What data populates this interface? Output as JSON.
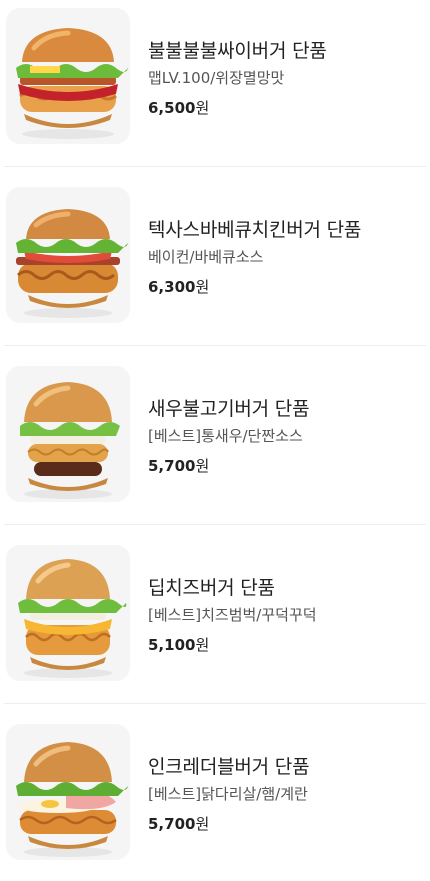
{
  "menu": {
    "items": [
      {
        "name": "불불불불싸이버거 단품",
        "desc": "맵LV.100/위장멸망맛",
        "price": "6,500",
        "unit": "원"
      },
      {
        "name": "텍사스바베큐치킨버거 단품",
        "desc": "베이컨/바베큐소스",
        "price": "6,300",
        "unit": "원"
      },
      {
        "name": "새우불고기버거 단품",
        "desc": "[베스트]통새우/단짠소스",
        "price": "5,700",
        "unit": "원"
      },
      {
        "name": "딥치즈버거 단품",
        "desc": "[베스트]치즈범벅/꾸덕꾸덕",
        "price": "5,100",
        "unit": "원"
      },
      {
        "name": "인크레더블버거 단품",
        "desc": "[베스트]닭다리살/햄/계란",
        "price": "5,700",
        "unit": "원"
      }
    ]
  }
}
